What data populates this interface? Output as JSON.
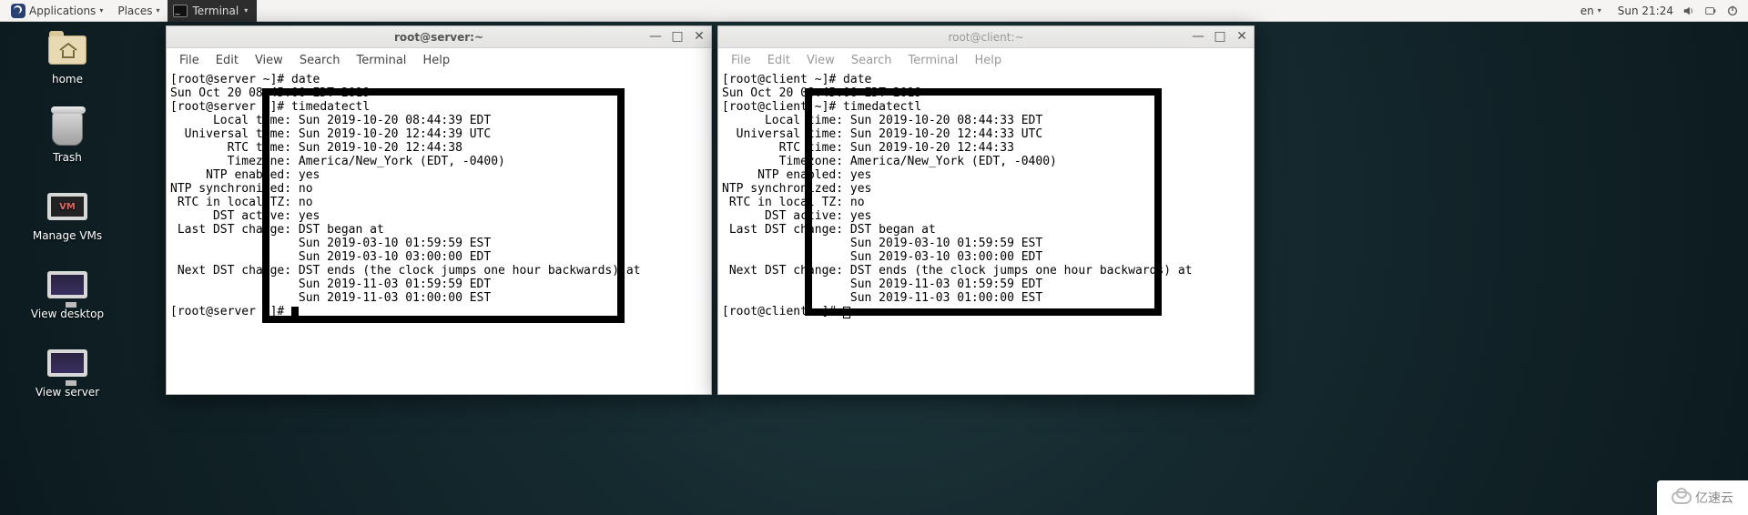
{
  "panel": {
    "applications": "Applications",
    "places": "Places",
    "active_app": "Terminal",
    "lang": "en",
    "clock": "Sun 21:24"
  },
  "desktop": {
    "home": "home",
    "trash": "Trash",
    "manage_vms": "Manage VMs",
    "view_desktop": "View desktop",
    "view_server": "View server"
  },
  "menubar": {
    "file": "File",
    "edit": "Edit",
    "view": "View",
    "search": "Search",
    "terminal": "Terminal",
    "help": "Help"
  },
  "term1": {
    "title": "root@server:~",
    "lines": [
      "[root@server ~]# date",
      "Sun Oct 20 08:45:00 EDT 2019",
      "[root@server ~]# timedatectl",
      "      Local time: Sun 2019-10-20 08:44:39 EDT",
      "  Universal time: Sun 2019-10-20 12:44:39 UTC",
      "        RTC time: Sun 2019-10-20 12:44:38",
      "        Timezone: America/New_York (EDT, -0400)",
      "     NTP enabled: yes",
      "NTP synchronized: no",
      " RTC in local TZ: no",
      "      DST active: yes",
      " Last DST change: DST began at",
      "                  Sun 2019-03-10 01:59:59 EST",
      "                  Sun 2019-03-10 03:00:00 EDT",
      " Next DST change: DST ends (the clock jumps one hour backwards) at",
      "                  Sun 2019-11-03 01:59:59 EDT",
      "                  Sun 2019-11-03 01:00:00 EST",
      "[root@server ~]# "
    ]
  },
  "term2": {
    "title": "root@client:~",
    "lines": [
      "[root@client ~]# date",
      "Sun Oct 20 08:45:00 EDT 2019",
      "[root@client ~]# timedatectl",
      "      Local time: Sun 2019-10-20 08:44:33 EDT",
      "  Universal time: Sun 2019-10-20 12:44:33 UTC",
      "        RTC time: Sun 2019-10-20 12:44:33",
      "        Timezone: America/New_York (EDT, -0400)",
      "     NTP enabled: yes",
      "NTP synchronized: yes",
      " RTC in local TZ: no",
      "      DST active: yes",
      " Last DST change: DST began at",
      "                  Sun 2019-03-10 01:59:59 EST",
      "                  Sun 2019-03-10 03:00:00 EDT",
      " Next DST change: DST ends (the clock jumps one hour backwards) at",
      "                  Sun 2019-11-03 01:59:59 EDT",
      "                  Sun 2019-11-03 01:00:00 EST",
      "[root@client ~]# "
    ]
  },
  "watermark": "亿速云"
}
